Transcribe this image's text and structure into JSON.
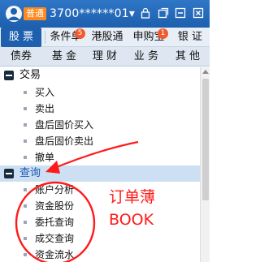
{
  "titlebar": {
    "badge": "普通",
    "account": "3700******01",
    "dropdown_glyph": "▾"
  },
  "tabs_row1": [
    {
      "label": "股 票",
      "active": true
    },
    {
      "label": "条件单",
      "badge": "5"
    },
    {
      "label": "港股通"
    },
    {
      "label": "申购宝",
      "badge": "1"
    },
    {
      "label": "银 证"
    }
  ],
  "tabs_row2": [
    {
      "label": "债券"
    },
    {
      "label": "基 金"
    },
    {
      "label": "理 财"
    },
    {
      "label": "业 务"
    },
    {
      "label": "其 他"
    }
  ],
  "tree": {
    "group_trade": {
      "label": "交易",
      "items": [
        "买入",
        "卖出",
        "盘后固价买入",
        "盘后固价卖出",
        "撤单"
      ]
    },
    "group_query": {
      "label": "查询",
      "items": [
        "账户分析",
        "资金股份",
        "委托查询",
        "成交查询",
        "资金流水"
      ]
    }
  },
  "annotation": {
    "line1": "订单薄",
    "line2": "BOOK",
    "color": "#ff1a1a"
  },
  "colors": {
    "titlebar": "#1e5fae",
    "accent": "#1e5fae",
    "selected_row": "#cde0f3",
    "badge_orange": "#ff8a1f"
  }
}
